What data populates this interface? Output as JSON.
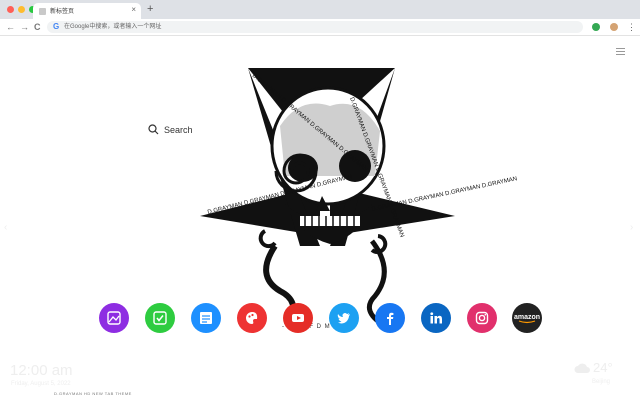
{
  "browser": {
    "tab_title": "新标签页",
    "tab_close": "×",
    "new_tab": "+",
    "address_placeholder": "在Google中搜索，或者输入一个网址",
    "back": "←",
    "forward": "→",
    "reload": "C",
    "window_colors": [
      "#ff5f57",
      "#febc2e",
      "#28c840"
    ]
  },
  "page": {
    "search_label": "Search",
    "poster_caption": "- [ R  O F D  M A N ]",
    "pentagram_text": "D.GRAYMAN D.GRAYMAN D.GRAYMAN D.GRAYMAN",
    "credit_text": "D.GRAYMAN HD NEW TAB THEME",
    "clock": "12:00 am",
    "date": "Friday, August 5, 2022",
    "temperature": "24°",
    "city": "Beijing",
    "left_arrow": "‹",
    "right_arrow": "›"
  },
  "apps": [
    {
      "name": "gallery",
      "color": "#8e2de2"
    },
    {
      "name": "tasks",
      "color": "#2ecc40"
    },
    {
      "name": "notes",
      "color": "#1e90ff"
    },
    {
      "name": "games",
      "color": "#ee3333"
    },
    {
      "name": "youtube",
      "color": "#e52d27"
    },
    {
      "name": "twitter",
      "color": "#1da1f2"
    },
    {
      "name": "facebook",
      "color": "#1877f2"
    },
    {
      "name": "linkedin",
      "color": "#0a66c2"
    },
    {
      "name": "instagram",
      "color": "#e1306c"
    },
    {
      "name": "amazon",
      "color": "#222222",
      "label": "amazon"
    }
  ]
}
